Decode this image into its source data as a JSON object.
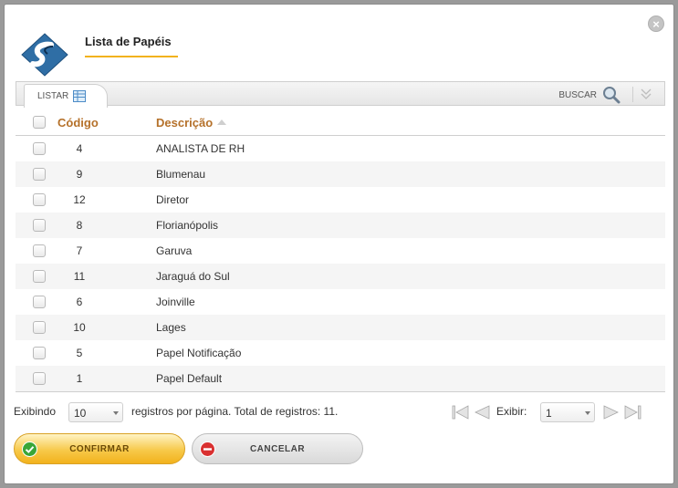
{
  "dialog": {
    "title": "Lista de Papéis",
    "close_icon": "close-icon",
    "accent": "#f2b21c"
  },
  "toolbar": {
    "tab_listar": "LISTAR",
    "buscar": "BUSCAR"
  },
  "grid": {
    "col_code": "Código",
    "col_desc": "Descrição",
    "rows": [
      {
        "code": "4",
        "desc": "ANALISTA DE RH"
      },
      {
        "code": "9",
        "desc": "Blumenau"
      },
      {
        "code": "12",
        "desc": "Diretor"
      },
      {
        "code": "8",
        "desc": "Florianópolis"
      },
      {
        "code": "7",
        "desc": "Garuva"
      },
      {
        "code": "11",
        "desc": "Jaraguá do Sul"
      },
      {
        "code": "6",
        "desc": "Joinville"
      },
      {
        "code": "10",
        "desc": "Lages"
      },
      {
        "code": "5",
        "desc": "Papel Notificação"
      },
      {
        "code": "1",
        "desc": "Papel Default"
      }
    ]
  },
  "pager": {
    "exibindo": "Exibindo",
    "page_size": "10",
    "summary": "registros por página. Total de registros: 11.",
    "exibir": "Exibir:",
    "page": "1"
  },
  "buttons": {
    "confirm": "CONFIRMAR",
    "cancel": "CANCELAR"
  }
}
